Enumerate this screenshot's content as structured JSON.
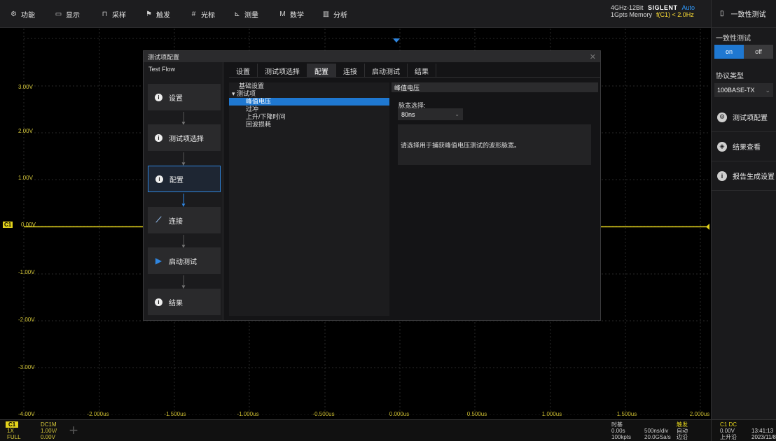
{
  "topbar": {
    "menu": [
      {
        "icon": "gear-icon",
        "glyph": "⚙",
        "label": "功能"
      },
      {
        "icon": "display-icon",
        "glyph": "▭",
        "label": "显示"
      },
      {
        "icon": "acquire-icon",
        "glyph": "⊓",
        "label": "采样"
      },
      {
        "icon": "trigger-icon",
        "glyph": "⚑",
        "label": "触发"
      },
      {
        "icon": "cursor-icon",
        "glyph": "#",
        "label": "光标"
      },
      {
        "icon": "measure-icon",
        "glyph": "⊾",
        "label": "测量"
      },
      {
        "icon": "math-icon",
        "glyph": "M",
        "label": "数学"
      },
      {
        "icon": "analysis-icon",
        "glyph": "▥",
        "label": "分析"
      }
    ],
    "spec_line1": "4GHz-12Bit",
    "spec_line2": "1Gpts Memory",
    "brand": "SIGLENT",
    "run_mode": "Auto",
    "trigger_freq": "f(C1) < 2.0Hz"
  },
  "right_panel": {
    "title": "一致性测试",
    "section_label": "一致性测试",
    "toggle_on": "on",
    "toggle_off": "off",
    "protocol_label": "协议类型",
    "protocol_value": "100BASE-TX",
    "buttons": [
      {
        "icon": "config-icon",
        "glyph": "⚙",
        "label": "测试项配置"
      },
      {
        "icon": "eye-icon",
        "glyph": "◈",
        "label": "结果查看"
      },
      {
        "icon": "info-icon",
        "glyph": "i",
        "label": "报告生成设置"
      }
    ]
  },
  "waveform": {
    "y_labels": [
      "3.00V",
      "2.00V",
      "1.00V",
      "0.00V",
      "-1.00V",
      "-2.00V",
      "-3.00V",
      "-4.00V"
    ],
    "x_labels": [
      "-2.000us",
      "-1.500us",
      "-1.000us",
      "-0.500us",
      "0.000us",
      "0.500us",
      "1.000us",
      "1.500us",
      "2.000us"
    ],
    "channel_marker": "C1",
    "trace_color": "#e3d31c",
    "accent_color": "#1f78d1"
  },
  "dialog": {
    "title": "测试项配置",
    "flow_title": "Test Flow",
    "steps": [
      {
        "icon": "info-icon",
        "label": "设置"
      },
      {
        "icon": "info-icon",
        "label": "测试项选择"
      },
      {
        "icon": "info-icon",
        "label": "配置"
      },
      {
        "icon": "connection-icon",
        "label": "连接"
      },
      {
        "icon": "play-icon",
        "label": "启动测试"
      },
      {
        "icon": "info-icon",
        "label": "结果"
      }
    ],
    "tabs": [
      "设置",
      "测试项选择",
      "配置",
      "连接",
      "启动测试",
      "结果"
    ],
    "active_tab": "配置",
    "tree": {
      "basic": "基础设置",
      "group": "测试项",
      "items": [
        "峰值电压",
        "过冲",
        "上升/下降时间",
        "回波损耗"
      ]
    },
    "detail": {
      "header": "峰值电压",
      "pulse_width_label": "脉宽选择:",
      "pulse_width_value": "80ns",
      "hint": "请选择用于捕获峰值电压测试的波形脉宽。"
    }
  },
  "bottom": {
    "ch_tag": "C1",
    "ch_coupling": "DC1M",
    "ch_probe": "1X",
    "ch_scale": "1.00V/",
    "ch_bw": "FULL",
    "ch_offset": "0.00V",
    "timebase_label": "时基",
    "timebase_delay": "0.00s",
    "timebase_points": "100kpts",
    "timebase_scale": "500ns/div",
    "sample_rate": "20.0GSa/s",
    "trigger_label": "触发",
    "trigger_mode": "自动",
    "trigger_type": "边沿",
    "trig_channel": "C1 DC",
    "trig_level": "0.00V",
    "trig_slope": "上升沿",
    "clock_time": "13:41:13",
    "clock_date": "2023/11/8"
  }
}
